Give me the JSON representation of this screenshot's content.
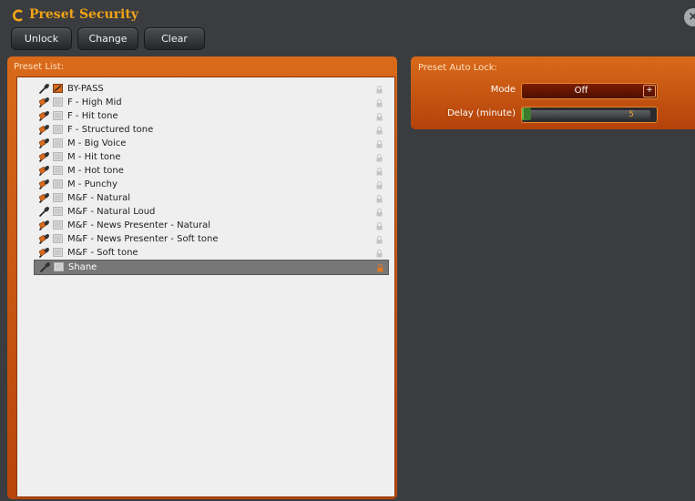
{
  "app": {
    "title": "Preset Security",
    "close_label": "×"
  },
  "toolbar": {
    "unlock_label": "Unlock",
    "change_label": "Change",
    "clear_label": "Clear"
  },
  "preset_list": {
    "header": "Preset List:",
    "items": [
      {
        "label": "BY-PASS",
        "icon": "microphone-icon",
        "badge": "bypass-badge-icon",
        "selected": false
      },
      {
        "label": "F - High Mid",
        "icon": "microphone-lock-icon",
        "badge": "preset-badge-icon",
        "selected": false
      },
      {
        "label": "F - Hit tone",
        "icon": "microphone-lock-icon",
        "badge": "preset-badge-icon",
        "selected": false
      },
      {
        "label": "F - Structured tone",
        "icon": "microphone-lock-icon",
        "badge": "preset-badge-icon",
        "selected": false
      },
      {
        "label": "M - Big Voice",
        "icon": "microphone-lock-icon",
        "badge": "preset-badge-icon",
        "selected": false
      },
      {
        "label": "M - Hit tone",
        "icon": "microphone-lock-icon",
        "badge": "preset-badge-icon",
        "selected": false
      },
      {
        "label": "M - Hot tone",
        "icon": "microphone-lock-icon",
        "badge": "preset-badge-icon",
        "selected": false
      },
      {
        "label": "M - Punchy",
        "icon": "microphone-lock-icon",
        "badge": "preset-badge-icon",
        "selected": false
      },
      {
        "label": "M&F - Natural",
        "icon": "microphone-lock-icon",
        "badge": "preset-badge-icon",
        "selected": false
      },
      {
        "label": "M&F - Natural Loud",
        "icon": "microphone-icon",
        "badge": "preset-badge-icon",
        "selected": false
      },
      {
        "label": "M&F - News Presenter - Natural",
        "icon": "microphone-lock-icon",
        "badge": "preset-badge-icon",
        "selected": false
      },
      {
        "label": "M&F - News Presenter - Soft tone",
        "icon": "microphone-lock-icon",
        "badge": "preset-badge-icon",
        "selected": false
      },
      {
        "label": "M&F - Soft tone",
        "icon": "microphone-lock-icon",
        "badge": "preset-badge-icon",
        "selected": false
      },
      {
        "label": "Shane",
        "icon": "microphone-icon",
        "badge": "preset-badge-icon",
        "selected": true
      }
    ]
  },
  "auto_lock": {
    "header": "Preset Auto Lock:",
    "mode_label": "Mode",
    "mode_value": "Off",
    "mode_plus": "+",
    "delay_label": "Delay (minute)",
    "delay_value": "5"
  },
  "colors": {
    "accent": "#f3a315",
    "panel_orange": "#d2600f",
    "background": "#3a3c3f",
    "selected_row": "#777777",
    "lock_locked": "#e07a22",
    "lock_unlocked": "#c4c4c4"
  }
}
